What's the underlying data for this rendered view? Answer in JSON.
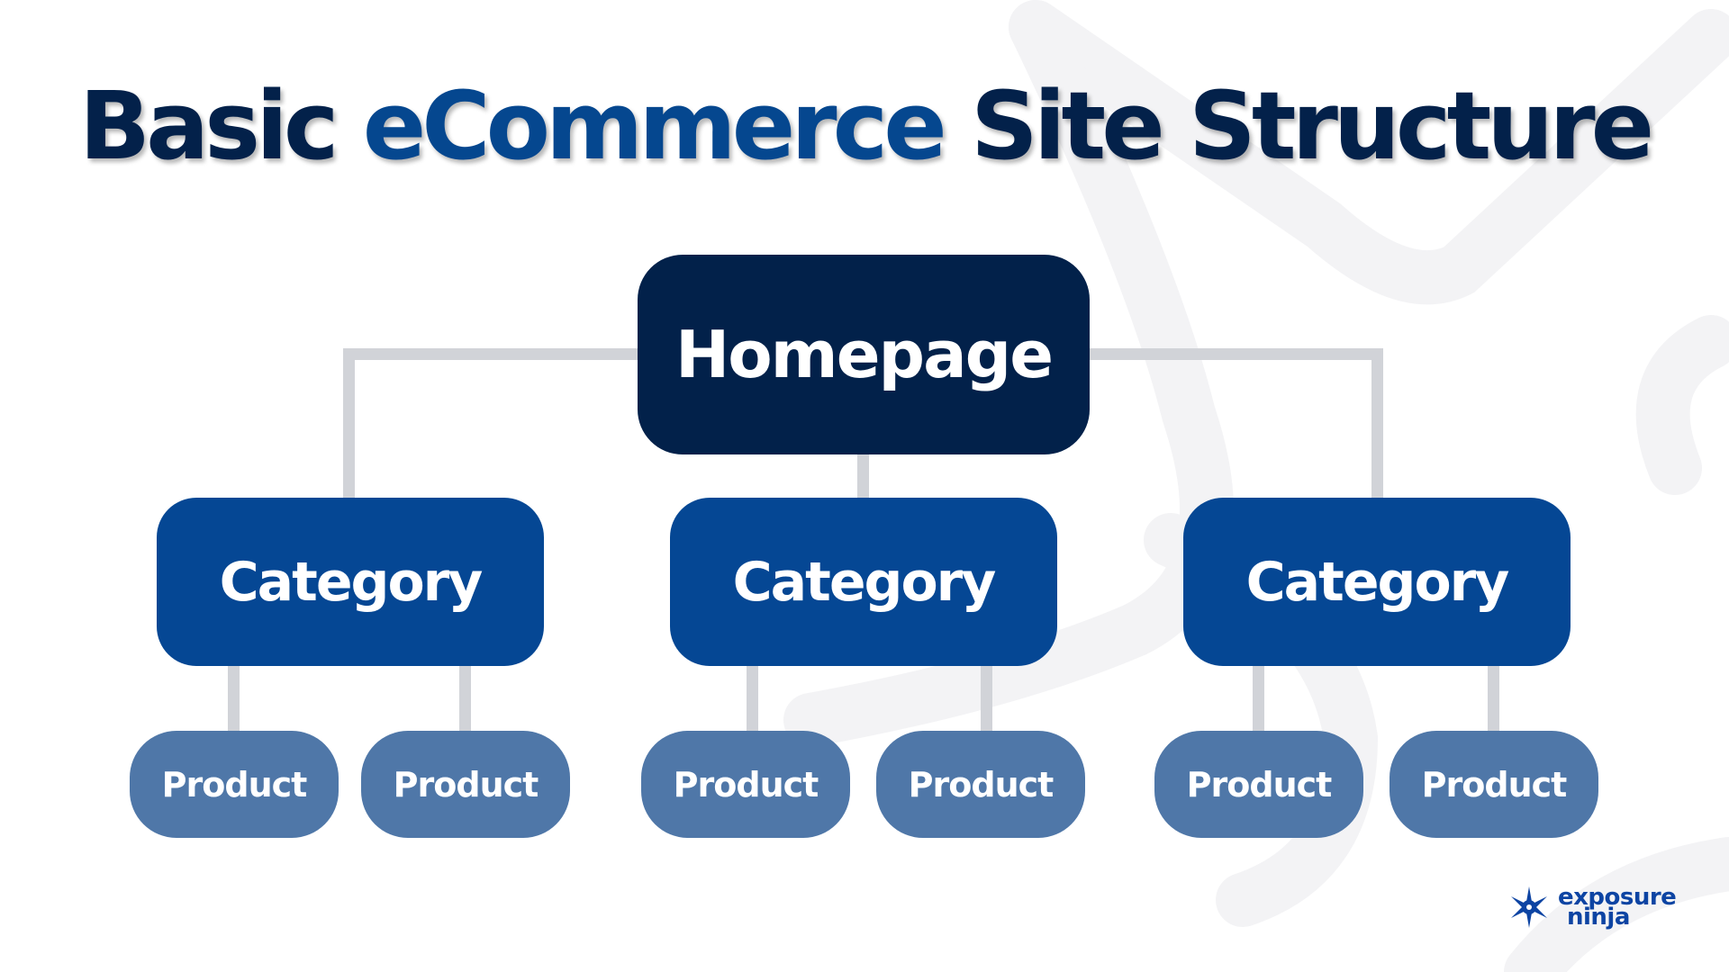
{
  "title": {
    "part1": "Basic ",
    "accent": "eCommerce",
    "part2": " Site Structure"
  },
  "colors": {
    "title_dark": "#03214a",
    "title_accent": "#05478f",
    "homepage_fill": "#02214a",
    "category_fill": "#054794",
    "product_fill": "#4f77a8",
    "connector": "#d1d3d8",
    "logo": "#0d44a3"
  },
  "tree": {
    "root": {
      "label": "Homepage"
    },
    "categories": [
      {
        "label": "Category",
        "products": [
          {
            "label": "Product"
          },
          {
            "label": "Product"
          }
        ]
      },
      {
        "label": "Category",
        "products": [
          {
            "label": "Product"
          },
          {
            "label": "Product"
          }
        ]
      },
      {
        "label": "Category",
        "products": [
          {
            "label": "Product"
          },
          {
            "label": "Product"
          }
        ]
      }
    ]
  },
  "logo": {
    "icon": "shuriken-star-icon",
    "line1": "exposure",
    "line2": "ninja"
  }
}
